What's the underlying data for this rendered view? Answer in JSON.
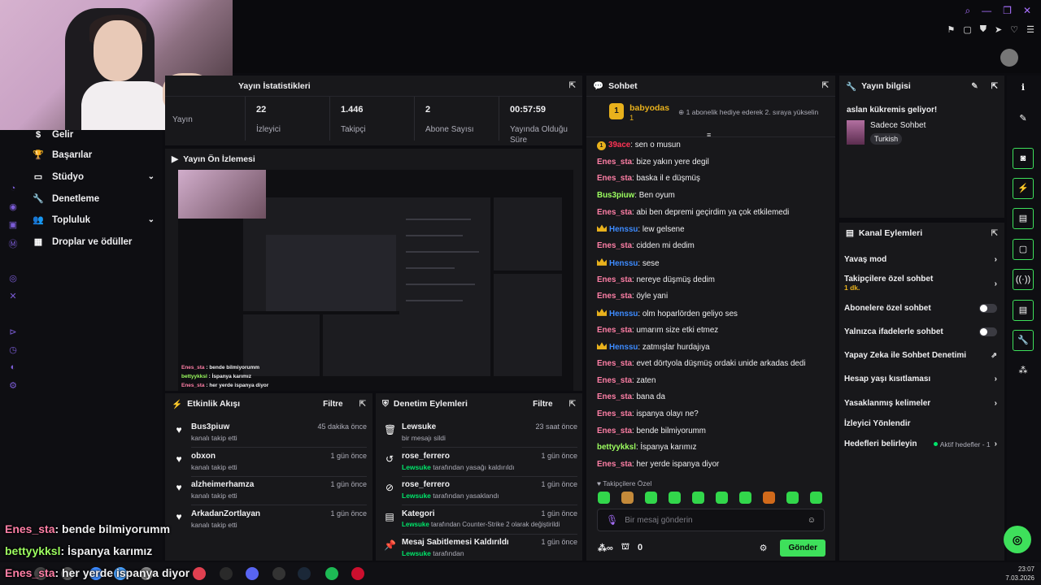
{
  "stats": {
    "title": "Yayın İstatistikleri",
    "items": [
      {
        "value": "",
        "label": "Yayın"
      },
      {
        "value": "22",
        "label": "İzleyici"
      },
      {
        "value": "1.446",
        "label": "Takipçi"
      },
      {
        "value": "2",
        "label": "Abone Sayısı"
      },
      {
        "value": "00:57:59",
        "label": "Yayında Olduğu Süre"
      }
    ]
  },
  "nav": {
    "items": [
      {
        "label": "Gelir",
        "icon": "dollar-icon"
      },
      {
        "label": "Başarılar",
        "icon": "trophy-icon"
      },
      {
        "label": "Stüdyo",
        "icon": "studio-icon"
      },
      {
        "label": "Denetleme",
        "icon": "wrench-icon"
      },
      {
        "label": "Topluluk",
        "icon": "people-icon"
      },
      {
        "label": "Droplar ve ödüller",
        "icon": "gift-icon"
      }
    ]
  },
  "preview": {
    "title": "Yayın Ön İzlemesi",
    "chat": [
      {
        "user": "Enes_sta",
        "text": "bende bilmiyorumm",
        "color": "#ff7fa6"
      },
      {
        "user": "bettyykksl",
        "text": "İspanya karımız",
        "color": "#9dff60"
      },
      {
        "user": "Enes_sta",
        "text": "her yerde ispanya diyor",
        "color": "#ff7fa6"
      }
    ]
  },
  "activity": {
    "title": "Etkinlik Akışı",
    "filter": "Filtre",
    "items": [
      {
        "name": "Bus3piuw",
        "desc": "kanalı takip etti",
        "time": "45 dakika önce"
      },
      {
        "name": "obxon",
        "desc": "kanalı takip etti",
        "time": "1 gün önce"
      },
      {
        "name": "alzheimerhamza",
        "desc": "kanalı takip etti",
        "time": "1 gün önce"
      },
      {
        "name": "ArkadanZortlayan",
        "desc": "kanalı takip etti",
        "time": "1 gün önce"
      }
    ]
  },
  "moderation": {
    "title": "Denetim Eylemleri",
    "filter": "Filtre",
    "items": [
      {
        "icon": "trash-icon",
        "name": "Lewsuke",
        "who": "",
        "desc": "bir mesajı sildi",
        "time": "23 saat önce"
      },
      {
        "icon": "undo-icon",
        "name": "rose_ferrero",
        "who": "Lewsuke",
        "desc": " tarafından yasağı kaldırıldı",
        "time": "1 gün önce"
      },
      {
        "icon": "ban-icon",
        "name": "rose_ferrero",
        "who": "Lewsuke",
        "desc": " tarafından yasaklandı",
        "time": "1 gün önce"
      },
      {
        "icon": "category-icon",
        "name": "Kategori",
        "who": "Lewsuke",
        "desc": " tarafından Counter-Strike 2 olarak değiştirildi",
        "time": "1 gün önce"
      },
      {
        "icon": "pin-icon",
        "name": "Mesaj Sabitlemesi Kaldırıldı",
        "who": "Lewsuke",
        "desc": " tarafından",
        "time": "1 gün önce"
      }
    ]
  },
  "chat": {
    "title": "Sohbet",
    "pinned_user": "babyodas",
    "pinned_count": "1",
    "pinned_text": "1 abonelik hediye ederek 2. sıraya yükselin",
    "messages": [
      {
        "user": "39ace",
        "text": ": sen o musun",
        "color": "#ff3355",
        "badge": "coin"
      },
      {
        "user": "Enes_sta",
        "text": ": bize yakın yere degil",
        "color": "#ff7fa6",
        "badge": ""
      },
      {
        "user": "Enes_sta",
        "text": ": baska il e düşmüş",
        "color": "#ff7fa6",
        "badge": ""
      },
      {
        "user": "Bus3piuw",
        "text": ": Ben oyum",
        "color": "#9dff60",
        "badge": ""
      },
      {
        "user": "Enes_sta",
        "text": ": abi ben depremi geçirdim ya çok etkilemedi",
        "color": "#ff7fa6",
        "badge": ""
      },
      {
        "user": "Henssu",
        "text": ": lew gelsene",
        "color": "#3d8bff",
        "badge": "crown"
      },
      {
        "user": "Enes_sta",
        "text": ": cidden mi dedim",
        "color": "#ff7fa6",
        "badge": ""
      },
      {
        "user": "Henssu",
        "text": ": sese",
        "color": "#3d8bff",
        "badge": "crown"
      },
      {
        "user": "Enes_sta",
        "text": ": nereye düşmüş dedim",
        "color": "#ff7fa6",
        "badge": ""
      },
      {
        "user": "Enes_sta",
        "text": ": öyle yani",
        "color": "#ff7fa6",
        "badge": ""
      },
      {
        "user": "Henssu",
        "text": ": olm hoparlörden geliyo ses",
        "color": "#3d8bff",
        "badge": "crown"
      },
      {
        "user": "Enes_sta",
        "text": ": umarım size etki etmez",
        "color": "#ff7fa6",
        "badge": ""
      },
      {
        "user": "Henssu",
        "text": ": zatmışlar hurdajıya",
        "color": "#3d8bff",
        "badge": "crown"
      },
      {
        "user": "Enes_sta",
        "text": ": evet dörtyola düşmüş ordaki unide arkadas dedi",
        "color": "#ff7fa6",
        "badge": ""
      },
      {
        "user": "Enes_sta",
        "text": ": zaten",
        "color": "#ff7fa6",
        "badge": ""
      },
      {
        "user": "Enes_sta",
        "text": ": bana da",
        "color": "#ff7fa6",
        "badge": ""
      },
      {
        "user": "Enes_sta",
        "text": ": ispanya olayı ne?",
        "color": "#ff7fa6",
        "badge": ""
      },
      {
        "user": "Enes_sta",
        "text": ": bende bilmiyorumm",
        "color": "#ff7fa6",
        "badge": ""
      },
      {
        "user": "bettyykksl",
        "text": ": İspanya karımız",
        "color": "#9dff60",
        "badge": ""
      },
      {
        "user": "Enes_sta",
        "text": ": her yerde ispanya diyor",
        "color": "#ff7fa6",
        "badge": ""
      }
    ],
    "followers_only": "Takipçilere Özel",
    "input_placeholder": "Bir mesaj gönderin",
    "points": "0",
    "send": "Gönder"
  },
  "info": {
    "title": "Yayın bilgisi",
    "stream_title": "aslan kükremis geliyor!",
    "category": "Sadece Sohbet",
    "tag": "Turkish"
  },
  "actions": {
    "title": "Kanal Eylemleri",
    "items": [
      {
        "label": "Yavaş mod",
        "sub": "",
        "control": "chevron"
      },
      {
        "label": "Takipçilere özel sohbet",
        "sub": "1 dk.",
        "control": "chevron"
      },
      {
        "label": "Abonelere özel sohbet",
        "sub": "",
        "control": "toggle"
      },
      {
        "label": "Yalnızca ifadelerle sohbet",
        "sub": "",
        "control": "toggle"
      },
      {
        "label": "Yapay Zeka ile Sohbet Denetimi",
        "sub": "",
        "control": "external"
      },
      {
        "label": "Hesap yaşı kısıtlaması",
        "sub": "",
        "control": "chevron"
      },
      {
        "label": "Yasaklanmış kelimeler",
        "sub": "",
        "control": "chevron"
      },
      {
        "label": "İzleyici Yönlendir",
        "sub": "",
        "control": ""
      },
      {
        "label": "Hedefleri belirleyin",
        "sub": "",
        "control": "chevron",
        "tag": "Aktif hedefler - 1"
      }
    ]
  },
  "overlay": [
    {
      "user": "Enes_sta",
      "text": ": bende bilmiyorumm",
      "color": "#ff7fa6"
    },
    {
      "user": "bettyykksl",
      "text": ": İspanya karımız",
      "color": "#9dff60"
    },
    {
      "user": "Enes_sta",
      "text": ": her yerde ispanya diyor",
      "color": "#ff7fa6"
    }
  ],
  "clock": {
    "time": "23:07",
    "date": "7.03.2026"
  },
  "colors": {
    "accent": "#3ee05b",
    "panel": "#18181b",
    "bg": "#0c0c10"
  }
}
